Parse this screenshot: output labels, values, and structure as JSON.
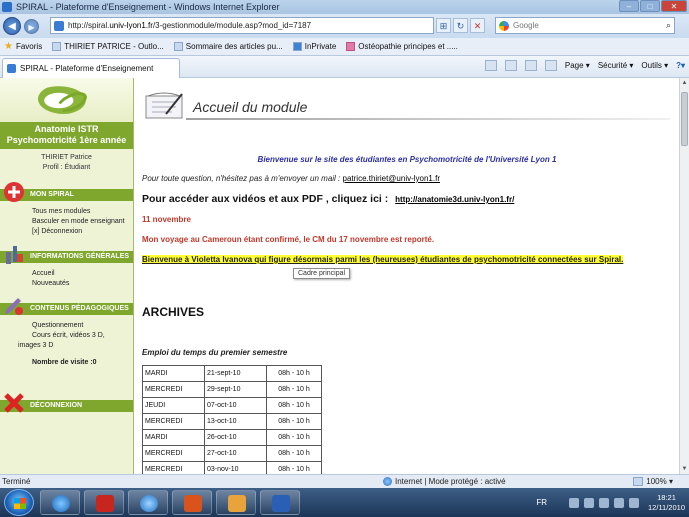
{
  "window": {
    "title": "SPIRAL - Plateforme d'Enseignement - Windows Internet Explorer",
    "controls": [
      "–",
      "□",
      "✕"
    ]
  },
  "address_bar": {
    "url_prefix": "http://spiral.",
    "url_domain": "univ-lyon1.fr",
    "url_rest": "/3-gestionmodule/module.asp?mod_id=7187",
    "search_placeholder": "Google"
  },
  "favorites_bar": {
    "favorites_label": "Favoris",
    "items": [
      "THIRIET PATRICE - Outlo...",
      "Sommaire des articles pu...",
      "InPrivate",
      "Ostéopathie principes et ....."
    ]
  },
  "command_bar": {
    "tab_label": "SPIRAL - Plateforme d'Enseignement",
    "page_menu": "Page ▾",
    "security_menu": "Sécurité ▾",
    "tools_menu": "Outils ▾",
    "help_menu": "?▾"
  },
  "sidebar": {
    "course_title_line1": "Anatomie ISTR",
    "course_title_line2": "Psychomotricité 1ère année",
    "user_name": "THIRIET Patrice",
    "user_role": "Profil : Étudiant",
    "sections": {
      "mon_spiral": {
        "title": "MON SPIRAL",
        "links": [
          "Tous mes modules",
          "Basculer en mode enseignant",
          "[x]  Déconnexion"
        ]
      },
      "infos": {
        "title": "INFORMATIONS GÉNÉRALES",
        "links": [
          "Accueil",
          "Nouveautés"
        ]
      },
      "contenus": {
        "title": "CONTENUS PÉDAGOGIQUES",
        "links": [
          "Questionnement",
          "Cours écrit, vidéos 3 D,",
          "images 3 D"
        ]
      },
      "deconnexion": {
        "title": "DÉCONNEXION"
      }
    },
    "visits_label": "Nombre de visite :0"
  },
  "main": {
    "heading": "Accueil du module",
    "welcome": "Bienvenue sur le site des étudiantes en Psychomotricité de l'Université Lyon 1",
    "question_text": "Pour toute question, n'hésitez pas à m'envoyer un mail : ",
    "question_email": "patrice.thiriet@univ-lyon1.fr",
    "videos_text": "Pour accéder aux vidéos et aux PDF , cliquez ici : ",
    "videos_link": "http://anatomie3d.univ-lyon1.fr/",
    "date": "11 novembre",
    "trip": "Mon voyage au Cameroun étant confirmé, le CM du 17 novembre est reporté.",
    "announcement": "Bienvenue à Violetta Ivanova qui figure désormais parmi les (heureuses) étudiantes de psychomotricité connectées sur Spiral. ",
    "tooltip": "Cadre principal",
    "archives": "ARCHIVES",
    "schedule_title": "Emploi du temps du premier semestre",
    "schedule_rows": [
      [
        "MARDI",
        "21-sept-10",
        "08h - 10 h"
      ],
      [
        "MERCREDI",
        "29-sept-10",
        "08h - 10 h"
      ],
      [
        "JEUDI",
        "07-oct-10",
        "08h - 10 h"
      ],
      [
        "MERCREDI",
        "13-oct-10",
        "08h - 10 h"
      ],
      [
        "MARDI",
        "26-oct-10",
        "08h - 10 h"
      ],
      [
        "MERCREDI",
        "27-oct-10",
        "08h - 10 h"
      ],
      [
        "MERCREDI",
        "03-nov-10",
        "08h - 10 h"
      ]
    ]
  },
  "status_bar": {
    "left": "Terminé",
    "zone": "Internet | Mode protégé : activé",
    "zoom": "100%"
  },
  "taskbar": {
    "language": "FR",
    "time": "18:21",
    "date": "12/11/2010"
  }
}
